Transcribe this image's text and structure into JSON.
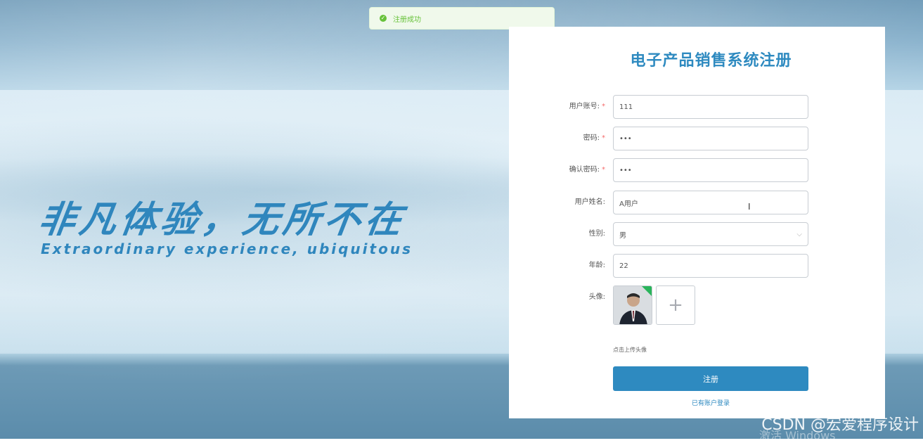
{
  "toast": {
    "text": "注册成功",
    "icon": "check-circle-icon",
    "color": "#67c23a"
  },
  "slogan": {
    "cn": "非凡体验，无所不在",
    "en": "Extraordinary experience, ubiquitous"
  },
  "form": {
    "title": "电子产品销售系统注册",
    "fields": {
      "account": {
        "label": "用户账号:",
        "value": "111",
        "required": true
      },
      "password": {
        "label": "密码:",
        "value": "•••",
        "required": true
      },
      "confirm": {
        "label": "确认密码:",
        "value": "•••",
        "required": true
      },
      "name": {
        "label": "用户姓名:",
        "value": "A用户"
      },
      "gender": {
        "label": "性别:",
        "value": "男"
      },
      "age": {
        "label": "年龄:",
        "value": "22"
      },
      "avatar": {
        "label": "头像:",
        "tip": "点击上传头像",
        "plus": "+"
      }
    },
    "submit_label": "注册",
    "login_link": "已有账户登录"
  },
  "overlay": {
    "watermark": "CSDN @宏爱程序设计",
    "activate": "激活 Windows"
  },
  "colors": {
    "accent": "#2e8ac0",
    "slogan": "#2f86bd"
  }
}
